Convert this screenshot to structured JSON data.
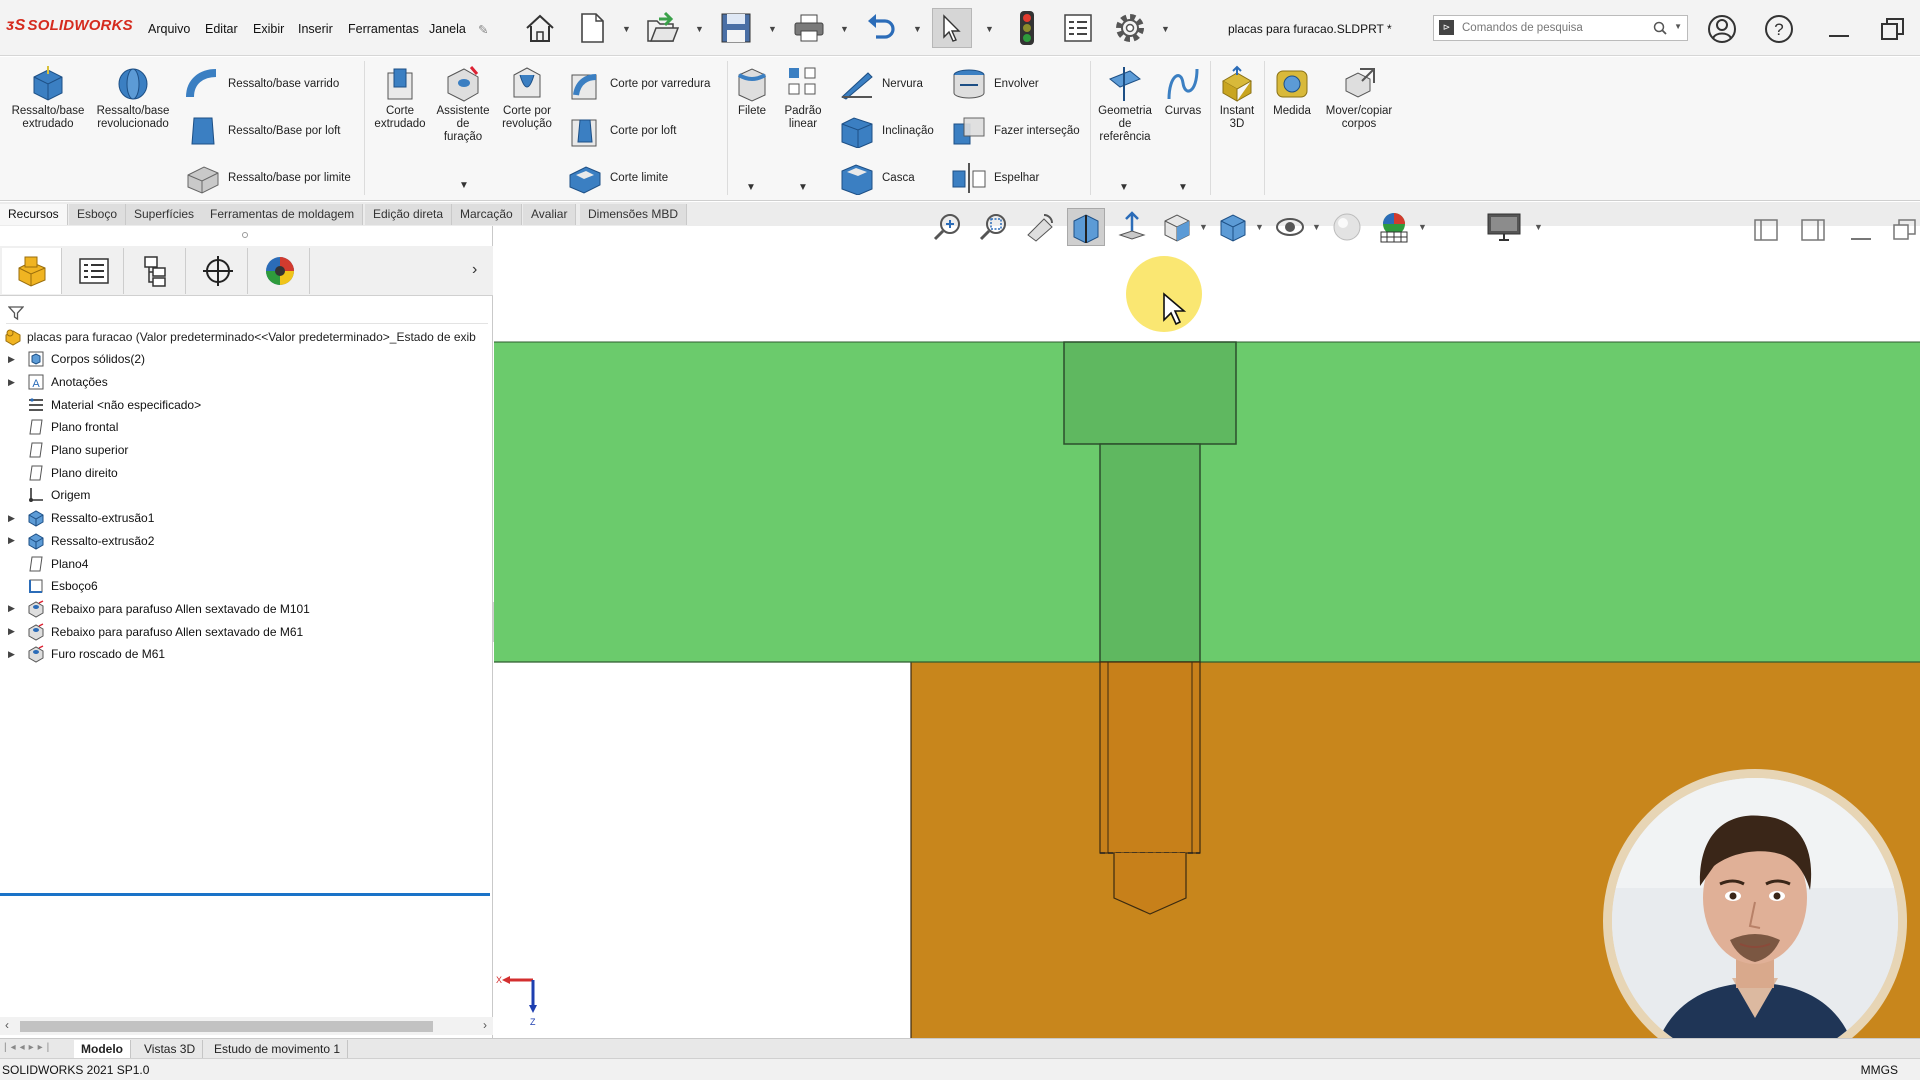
{
  "app": {
    "brand": "SOLIDWORKS",
    "document_title": "placas para furacao.SLDPRT *"
  },
  "menu": [
    "Arquivo",
    "Editar",
    "Exibir",
    "Inserir",
    "Ferramentas",
    "Janela"
  ],
  "search": {
    "placeholder": "Comandos de pesquisa"
  },
  "ribbon": {
    "big_buttons": [
      {
        "label": "Ressalto/base\nextrudado",
        "icon": "extruded-boss-icon"
      },
      {
        "label": "Ressalto/base\nrevolucionado",
        "icon": "revolved-boss-icon"
      },
      {
        "label": "Corte\nextrudado",
        "icon": "extruded-cut-icon"
      },
      {
        "label": "Assistente\nde\nfuração",
        "icon": "hole-wizard-icon"
      },
      {
        "label": "Corte por\nrevolução",
        "icon": "revolved-cut-icon"
      },
      {
        "label": "Filete",
        "icon": "fillet-icon"
      },
      {
        "label": "Padrão\nlinear",
        "icon": "linear-pattern-icon"
      },
      {
        "label": "Geometria\nde\nreferência",
        "icon": "reference-geometry-icon"
      },
      {
        "label": "Curvas",
        "icon": "curves-icon"
      },
      {
        "label": "Instant\n3D",
        "icon": "instant3d-icon"
      },
      {
        "label": "Medida",
        "icon": "measure-icon"
      },
      {
        "label": "Mover/copiar\ncorpos",
        "icon": "move-copy-icon"
      }
    ],
    "small_buttons": [
      {
        "label": "Ressalto/base varrido",
        "icon": "swept-boss-icon"
      },
      {
        "label": "Ressalto/Base por loft",
        "icon": "lofted-boss-icon"
      },
      {
        "label": "Ressalto/base por limite",
        "icon": "boundary-boss-icon"
      },
      {
        "label": "Corte por varredura",
        "icon": "swept-cut-icon"
      },
      {
        "label": "Corte por loft",
        "icon": "lofted-cut-icon"
      },
      {
        "label": "Corte limite",
        "icon": "boundary-cut-icon"
      },
      {
        "label": "Nervura",
        "icon": "rib-icon"
      },
      {
        "label": "Inclinação",
        "icon": "draft-icon"
      },
      {
        "label": "Casca",
        "icon": "shell-icon"
      },
      {
        "label": "Envolver",
        "icon": "wrap-icon"
      },
      {
        "label": "Fazer interseção",
        "icon": "intersect-icon"
      },
      {
        "label": "Espelhar",
        "icon": "mirror-icon"
      }
    ]
  },
  "command_tabs": [
    "Recursos",
    "Esboço",
    "Superfícies",
    "Ferramentas de moldagem",
    "Edição direta",
    "Marcação",
    "Avaliar",
    "Dimensões MBD"
  ],
  "feature_tree": {
    "root": "placas para furacao  (Valor predeterminado<<Valor predeterminado>_Estado de exib",
    "nodes": [
      {
        "label": "Corpos sólidos(2)",
        "expandable": true,
        "icon": "solid-bodies-icon"
      },
      {
        "label": "Anotações",
        "expandable": true,
        "icon": "annotations-icon"
      },
      {
        "label": "Material <não especificado>",
        "expandable": false,
        "icon": "material-icon"
      },
      {
        "label": "Plano frontal",
        "expandable": false,
        "icon": "plane-icon"
      },
      {
        "label": "Plano superior",
        "expandable": false,
        "icon": "plane-icon"
      },
      {
        "label": "Plano direito",
        "expandable": false,
        "icon": "plane-icon"
      },
      {
        "label": "Origem",
        "expandable": false,
        "icon": "origin-icon"
      },
      {
        "label": "Ressalto-extrusão1",
        "expandable": true,
        "icon": "extrude-feature-icon"
      },
      {
        "label": "Ressalto-extrusão2",
        "expandable": true,
        "icon": "extrude-feature-icon"
      },
      {
        "label": "Plano4",
        "expandable": false,
        "icon": "plane-icon"
      },
      {
        "label": "Esboço6",
        "expandable": false,
        "icon": "sketch-icon"
      },
      {
        "label": "Rebaixo para parafuso Allen sextavado de M101",
        "expandable": true,
        "icon": "hole-feature-icon"
      },
      {
        "label": "Rebaixo para parafuso Allen sextavado de M61",
        "expandable": true,
        "icon": "hole-feature-icon"
      },
      {
        "label": "Furo roscado de M61",
        "expandable": true,
        "icon": "hole-feature-icon"
      }
    ]
  },
  "bottom_tabs": [
    "Modelo",
    "Vistas 3D",
    "Estudo de movimento 1"
  ],
  "status": {
    "left": "SOLIDWORKS 2021 SP1.0",
    "right": "MMGS"
  },
  "viewport": {
    "triad_x": "X",
    "triad_z": "Z",
    "colors": {
      "top_plate": "#6bcb6c",
      "bottom_plate": "#c8861c",
      "bolt_green": "#5fb860",
      "bolt_orange": "#c7801a"
    }
  },
  "colors": {
    "brand_red": "#d52b1e",
    "selection_blue": "#1a73c8"
  }
}
